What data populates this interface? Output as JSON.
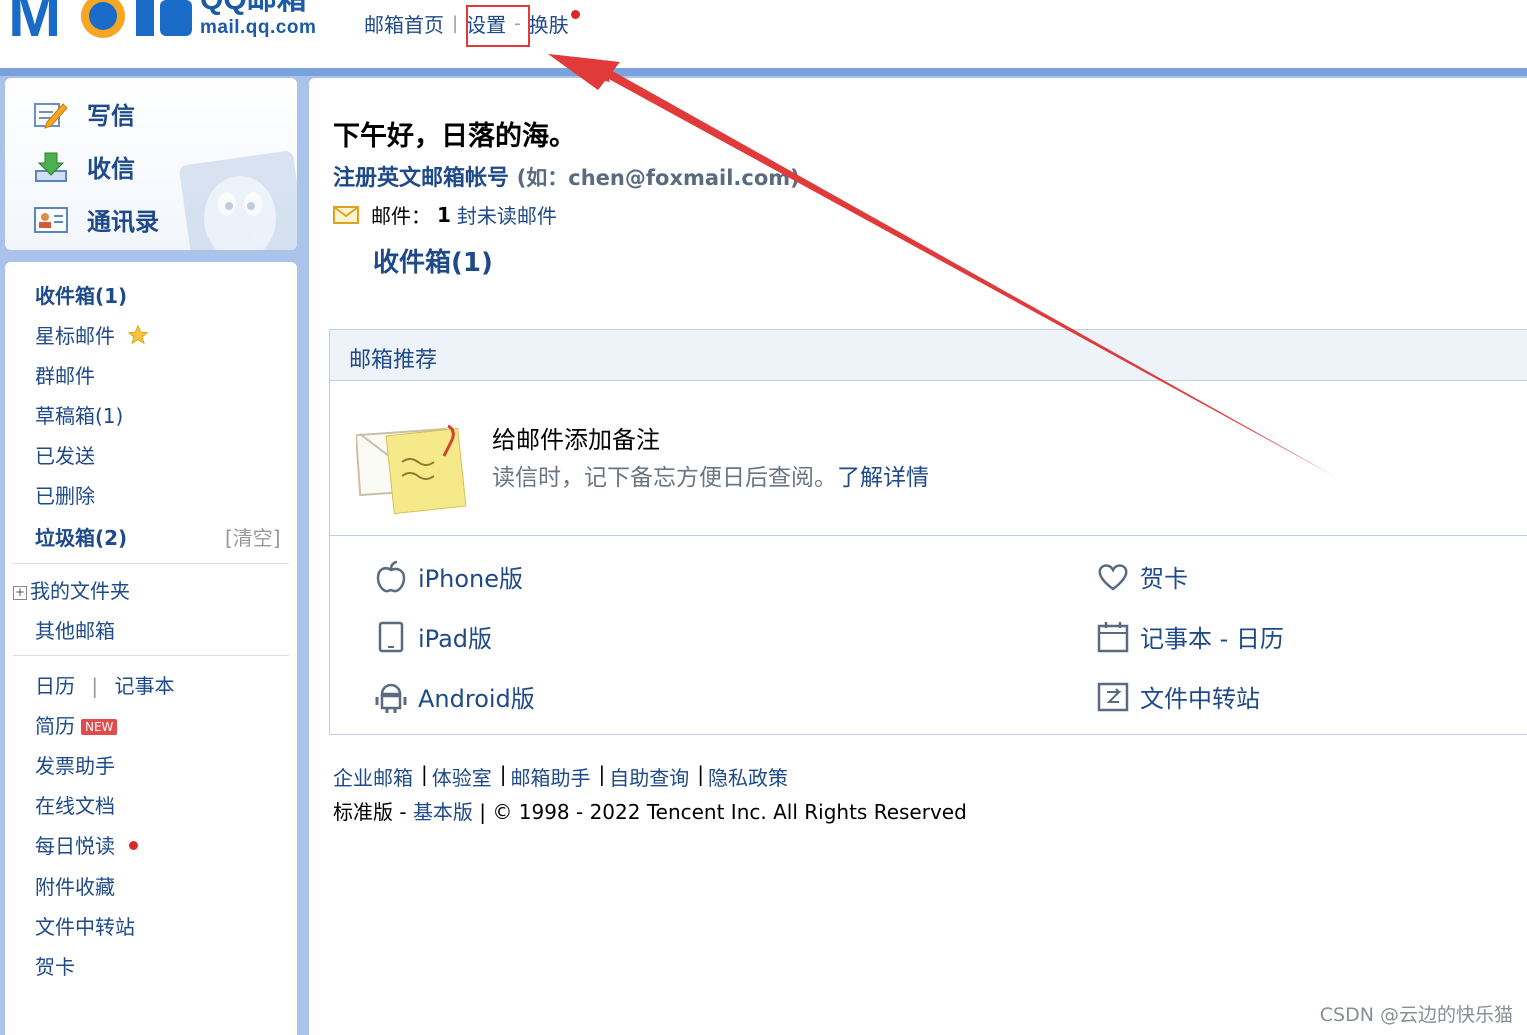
{
  "header": {
    "logo_brand": "QQ邮箱",
    "logo_domain": "mail.qq.com",
    "nav": {
      "home": "邮箱首页",
      "settings": "设置",
      "skin": "换肤"
    }
  },
  "compose": {
    "write": "写信",
    "receive": "收信",
    "contacts": "通讯录"
  },
  "sidebar": {
    "inbox": "收件箱(1)",
    "starred": "星标邮件",
    "group": "群邮件",
    "drafts": "草稿箱(1)",
    "sent": "已发送",
    "deleted": "已删除",
    "spam": "垃圾箱(2)",
    "clear": "[清空]",
    "my_folders": "我的文件夹",
    "other_mailbox": "其他邮箱",
    "calendar": "日历",
    "notebook": "记事本",
    "resume": "简历",
    "new_badge": "NEW",
    "invoice": "发票助手",
    "docs": "在线文档",
    "daily_read": "每日悦读",
    "attachments": "附件收藏",
    "file_transfer": "文件中转站",
    "cards": "贺卡"
  },
  "main": {
    "greeting": "下午好，日落的海。",
    "register": "注册英文邮箱帐号",
    "register_example": "(如：chen@foxmail.com)",
    "mail_label": "邮件：",
    "mail_count": "1",
    "mail_unread": "封未读邮件",
    "inbox_big": "收件箱(1)"
  },
  "recommend": {
    "title": "邮箱推荐",
    "feature_title": "给邮件添加备注",
    "feature_desc": "读信时，记下备忘方便日后查阅。",
    "feature_more": "了解详情",
    "apps": {
      "iphone": "iPhone版",
      "ipad": "iPad版",
      "android": "Android版",
      "cards": "贺卡",
      "notebook_calendar": "记事本 - 日历",
      "file_transfer": "文件中转站"
    }
  },
  "footer": {
    "links": [
      "企业邮箱",
      "体验室",
      "邮箱助手",
      "自助查询",
      "隐私政策"
    ],
    "standard": "标准版",
    "dash": " - ",
    "basic": "基本版",
    "copyright": " | © 1998 - 2022 Tencent Inc. All Rights Reserved"
  },
  "watermark": "CSDN @云边的快乐猫",
  "colors": {
    "accent_blue": "#1e4a8a",
    "band_blue": "#a9c3ea",
    "annotation_red": "#e03a3a"
  }
}
